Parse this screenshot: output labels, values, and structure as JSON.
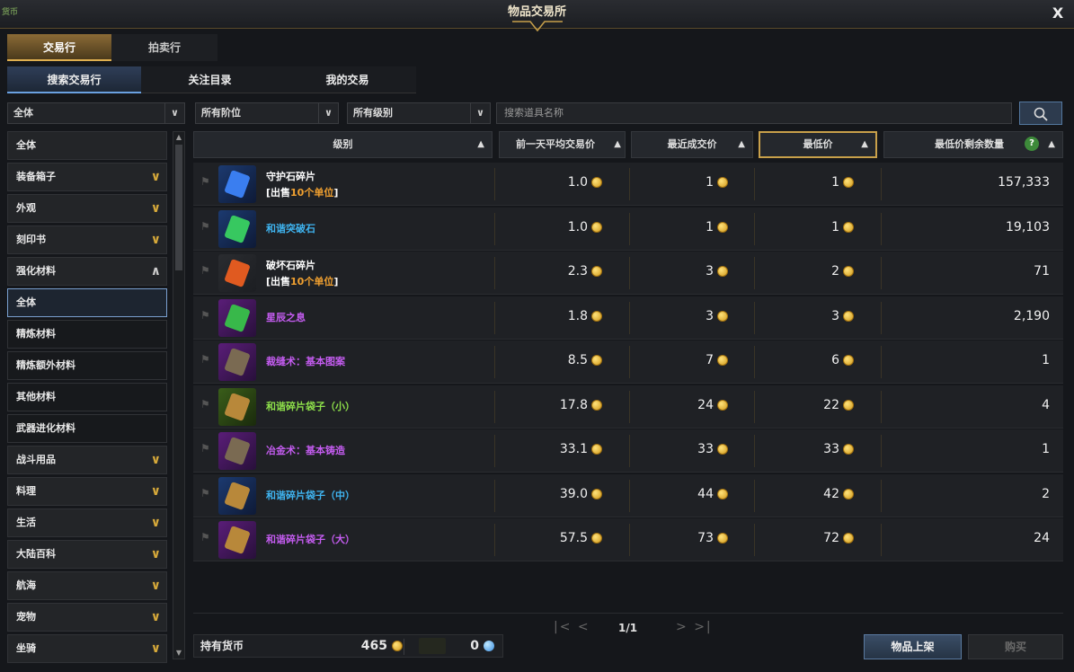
{
  "window": {
    "title": "物品交易所",
    "corner_text": "货币",
    "close_label": "X"
  },
  "top_tabs": [
    {
      "label": "交易行"
    },
    {
      "label": "拍卖行"
    }
  ],
  "sub_tabs": [
    {
      "label": "搜索交易行"
    },
    {
      "label": "关注目录"
    },
    {
      "label": "我的交易"
    }
  ],
  "filters": {
    "category": "全体",
    "tier": "所有阶位",
    "level": "所有级别",
    "search_placeholder": "搜索道具名称"
  },
  "sidebar": {
    "items": [
      {
        "label": "全体",
        "type": "top"
      },
      {
        "label": "装备箱子",
        "type": "expand"
      },
      {
        "label": "外观",
        "type": "expand"
      },
      {
        "label": "刻印书",
        "type": "expand"
      },
      {
        "label": "强化材料",
        "type": "collapse"
      },
      {
        "label": "全体",
        "type": "sub-selected"
      },
      {
        "label": "精炼材料",
        "type": "sub"
      },
      {
        "label": "精炼额外材料",
        "type": "sub"
      },
      {
        "label": "其他材料",
        "type": "sub"
      },
      {
        "label": "武器进化材料",
        "type": "sub"
      },
      {
        "label": "战斗用品",
        "type": "expand"
      },
      {
        "label": "料理",
        "type": "expand"
      },
      {
        "label": "生活",
        "type": "expand"
      },
      {
        "label": "大陆百科",
        "type": "expand"
      },
      {
        "label": "航海",
        "type": "expand"
      },
      {
        "label": "宠物",
        "type": "expand"
      },
      {
        "label": "坐骑",
        "type": "expand"
      }
    ]
  },
  "table": {
    "headers": [
      "级别",
      "前一天平均交易价",
      "最近成交价",
      "最低价",
      "最低价剩余数量"
    ],
    "sort_icon": "▲",
    "help_icon": "?",
    "rows": [
      {
        "name": "守护石碎片",
        "note": "[出售10个单位]",
        "note_highlight": "10个单位",
        "avg": "1.0",
        "recent": "1",
        "lowest": "1",
        "qty": "157,333",
        "name_color": "#ffffff",
        "icon": "blue-crystal-icon",
        "grade": "blue"
      },
      {
        "name": "和谐突破石",
        "note": "",
        "avg": "1.0",
        "recent": "1",
        "lowest": "1",
        "qty": "19,103",
        "name_color": "#3fb4f0",
        "icon": "green-gem-icon",
        "grade": "blue"
      },
      {
        "name": "破坏石碎片",
        "note": "[出售10个单位]",
        "note_highlight": "10个单位",
        "avg": "2.3",
        "recent": "3",
        "lowest": "2",
        "qty": "71",
        "name_color": "#ffffff",
        "icon": "red-crystal-icon",
        "grade": "plain"
      },
      {
        "name": "星辰之息",
        "note": "",
        "avg": "1.8",
        "recent": "3",
        "lowest": "3",
        "qty": "2,190",
        "name_color": "#c45cf0",
        "icon": "green-orb-icon",
        "grade": "purple"
      },
      {
        "name": "裁缝术：基本图案",
        "note": "",
        "avg": "8.5",
        "recent": "7",
        "lowest": "6",
        "qty": "1",
        "name_color": "#c45cf0",
        "icon": "book-icon",
        "grade": "purple"
      },
      {
        "name": "和谐碎片袋子（小）",
        "note": "",
        "avg": "17.8",
        "recent": "24",
        "lowest": "22",
        "qty": "4",
        "name_color": "#8ee04a",
        "icon": "pouch-small-icon",
        "grade": "green"
      },
      {
        "name": "冶金术：基本铸造",
        "note": "",
        "avg": "33.1",
        "recent": "33",
        "lowest": "33",
        "qty": "1",
        "name_color": "#c45cf0",
        "icon": "book-sword-icon",
        "grade": "purple"
      },
      {
        "name": "和谐碎片袋子（中）",
        "note": "",
        "avg": "39.0",
        "recent": "44",
        "lowest": "42",
        "qty": "2",
        "name_color": "#3fb4f0",
        "icon": "pouch-medium-icon",
        "grade": "blue"
      },
      {
        "name": "和谐碎片袋子（大）",
        "note": "",
        "avg": "57.5",
        "recent": "73",
        "lowest": "72",
        "qty": "24",
        "name_color": "#c45cf0",
        "icon": "pouch-large-icon",
        "grade": "purple"
      }
    ]
  },
  "pagination": {
    "first": "|<",
    "prev": "<",
    "page": "1/1",
    "next": ">",
    "last": ">|"
  },
  "wallet": {
    "label": "持有货币",
    "gold": "465",
    "crystal": "0"
  },
  "buttons": {
    "list": "物品上架",
    "buy": "购买"
  }
}
